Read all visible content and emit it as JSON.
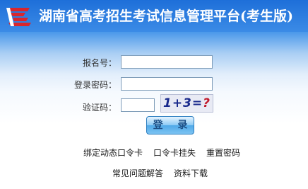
{
  "header": {
    "title": "湖南省高考招生考试信息管理平台(考生版)",
    "logo_icon": "hunan-exam-logo-icon"
  },
  "form": {
    "registration_label": "报名号：",
    "registration_value": "",
    "password_label": "登录密码：",
    "password_value": "",
    "captcha_label": "验证码：",
    "captcha_value": "",
    "captcha_text": "1+3=",
    "captcha_question": "?",
    "login_label": "登 录"
  },
  "links": {
    "bind_token": "绑定动态口令卡",
    "report_loss": "口令卡挂失",
    "reset_password": "重置密码",
    "faq": "常见问题解答",
    "downloads": "资料下载"
  },
  "colors": {
    "header_blue": "#1e6fd9",
    "logo_red": "#d8262d",
    "button_blue": "#4fa9e8"
  }
}
